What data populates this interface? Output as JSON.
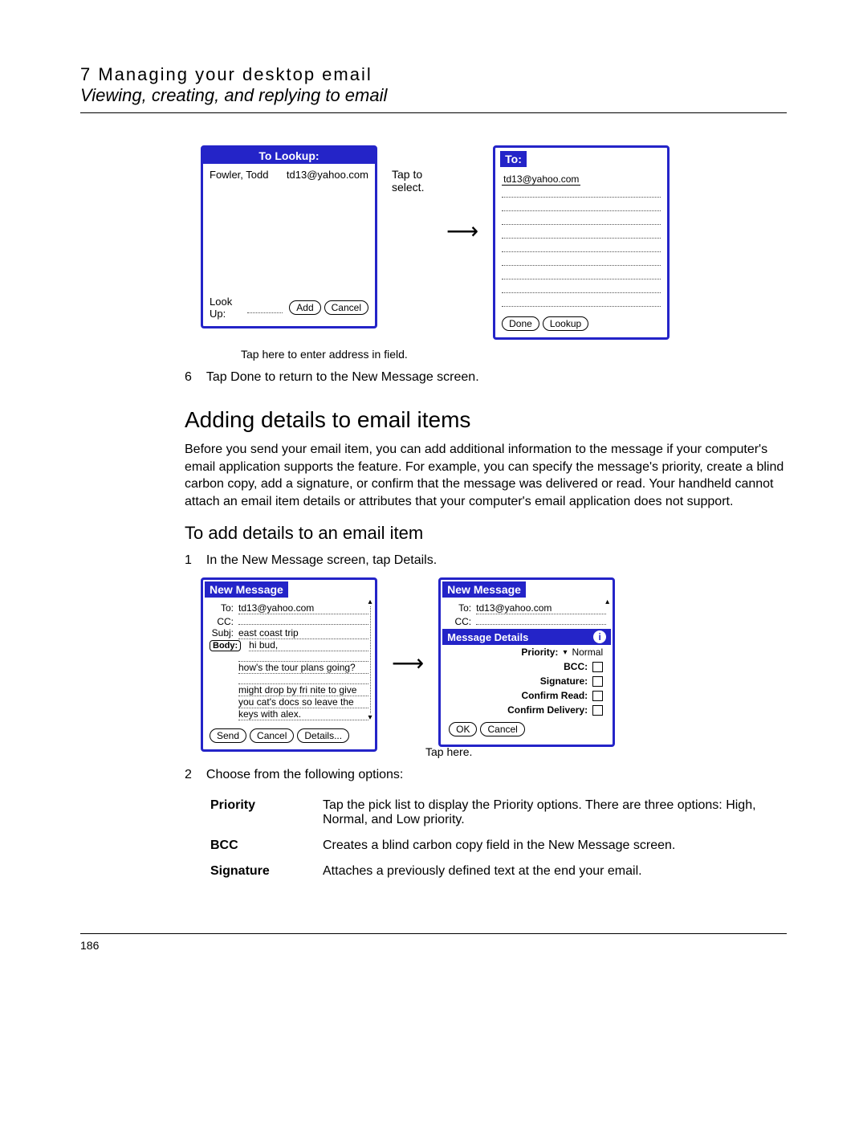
{
  "header": {
    "chapter": "7 Managing your desktop email",
    "section": "Viewing, creating, and replying to email"
  },
  "lookup_screen": {
    "title": "To Lookup:",
    "contact_name": "Fowler, Todd",
    "contact_email": "td13@yahoo.com",
    "lookup_label": "Look Up:",
    "add_btn": "Add",
    "cancel_btn": "Cancel"
  },
  "annot": {
    "tap_select": "Tap to select.",
    "tap_enter": "Tap here to enter address in field.",
    "tap_here": "Tap here."
  },
  "to_screen": {
    "title": "To:",
    "value": "td13@yahoo.com",
    "done_btn": "Done",
    "lookup_btn": "Lookup"
  },
  "step6": {
    "num": "6",
    "text": "Tap Done to return to the New Message screen."
  },
  "h2": "Adding details to email items",
  "para1": "Before you send your email item, you can add additional information to the message if your computer's email application supports the feature. For example, you can specify the message's priority, create a blind carbon copy, add a signature, or confirm that the message was delivered or read. Your handheld cannot attach an email item details or attributes that your computer's email application does not support.",
  "h3": "To add details to an email item",
  "step1": {
    "num": "1",
    "text": "In the New Message screen, tap Details."
  },
  "newmsg": {
    "title": "New Message",
    "to_lbl": "To:",
    "to_val": "td13@yahoo.com",
    "cc_lbl": "CC:",
    "subj_lbl": "Subj:",
    "subj_val": "east coast trip",
    "body_lbl": "Body:",
    "body1": "hi bud,",
    "body2": "how's the tour plans going?",
    "body3": "might drop by fri nite to give",
    "body4": "you cat's docs so leave the",
    "body5": "keys with alex.",
    "send_btn": "Send",
    "cancel_btn": "Cancel",
    "details_btn": "Details..."
  },
  "details": {
    "title": "Message Details",
    "priority_lbl": "Priority:",
    "priority_val": "Normal",
    "bcc_lbl": "BCC:",
    "sig_lbl": "Signature:",
    "read_lbl": "Confirm Read:",
    "deliv_lbl": "Confirm Delivery:",
    "ok_btn": "OK",
    "cancel_btn": "Cancel"
  },
  "step2": {
    "num": "2",
    "text": "Choose from the following options:"
  },
  "options": {
    "priority_k": "Priority",
    "priority_v": "Tap the pick list to display the Priority options. There are three options: High, Normal, and Low priority.",
    "bcc_k": "BCC",
    "bcc_v": "Creates a blind carbon copy field in the New Message screen.",
    "sig_k": "Signature",
    "sig_v": "Attaches a previously defined text at the end your email."
  },
  "page_number": "186"
}
